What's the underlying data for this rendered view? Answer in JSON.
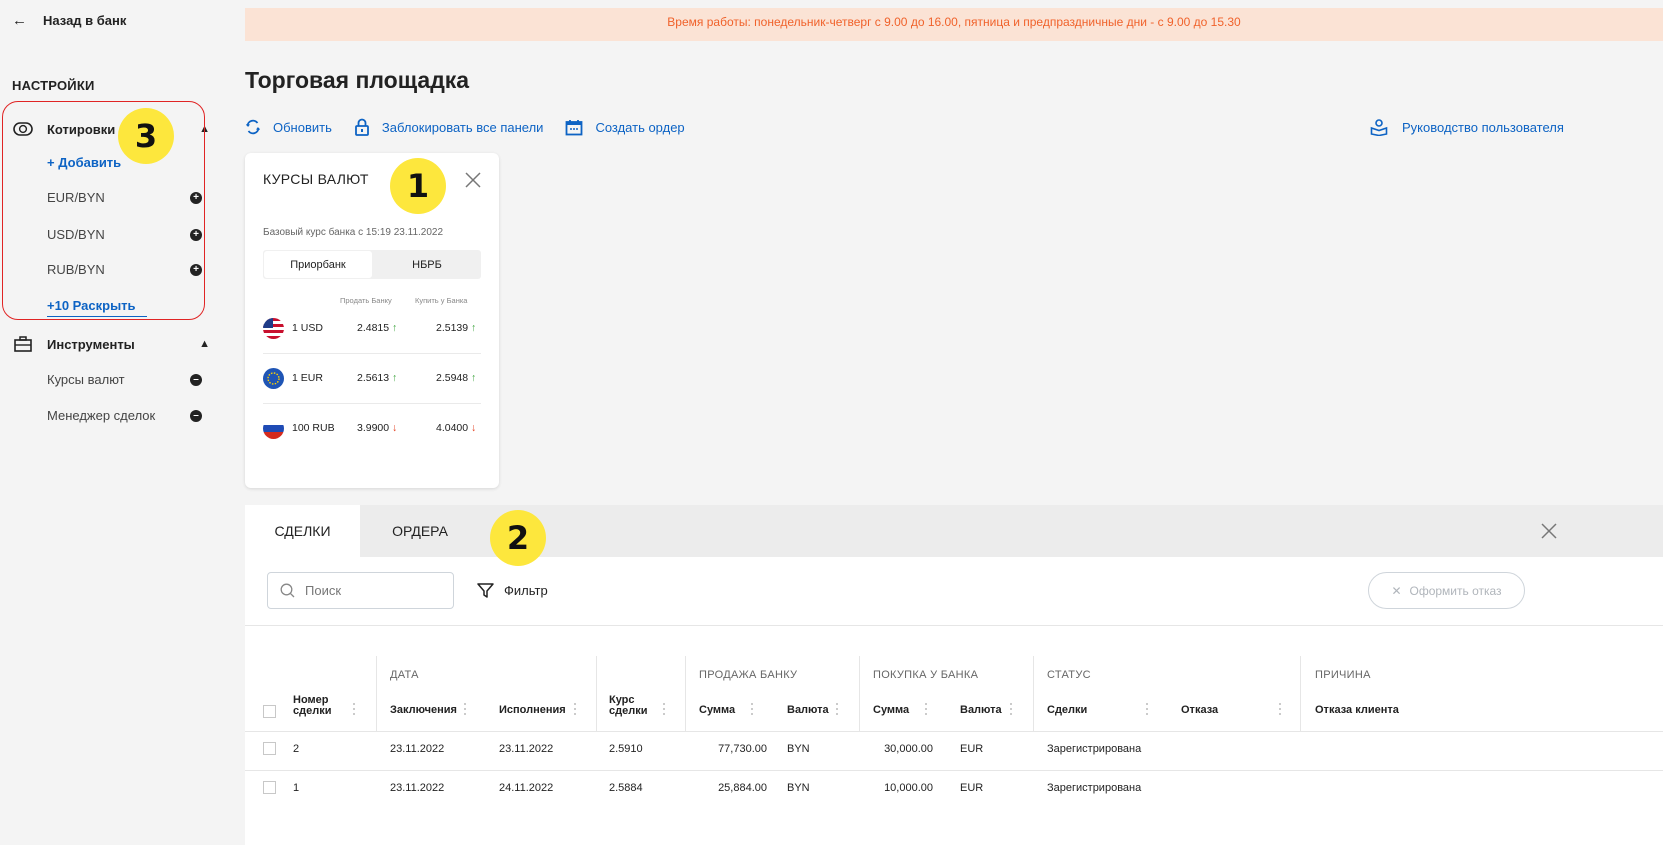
{
  "sidebar": {
    "back_label": "Назад в банк",
    "section_title": "НАСТРОЙКИ",
    "quotes": {
      "label": "Котировки",
      "add_label": "+ Добавить",
      "items": [
        "EUR/BYN",
        "USD/BYN",
        "RUB/BYN"
      ],
      "expand_label": "+10 Раскрыть"
    },
    "tools": {
      "label": "Инструменты",
      "items": [
        "Курсы валют",
        "Менеджер сделок"
      ]
    }
  },
  "annotations": {
    "badge1": "1",
    "badge2": "2",
    "badge3": "3"
  },
  "banner": "Время работы: понедельник-четверг с 9.00 до 16.00, пятница и предпраздничные дни - с 9.00 до 15.30",
  "page_title": "Торговая площадка",
  "toolbar": {
    "refresh": "Обновить",
    "lock_all": "Заблокировать все панели",
    "create_order": "Создать ордер",
    "user_guide": "Руководство пользователя"
  },
  "rates_card": {
    "title": "КУРСЫ ВАЛЮТ",
    "subtitle": "Базовый курс банка с 15:19 23.11.2022",
    "tabs": [
      "Приорбанк",
      "НБРБ"
    ],
    "col_sell": "Продать Банку",
    "col_buy": "Купить у Банка",
    "rows": [
      {
        "currency": "1 USD",
        "sell": "2.4815",
        "buy": "2.5139",
        "sell_dir": "up",
        "buy_dir": "up"
      },
      {
        "currency": "1 EUR",
        "sell": "2.5613",
        "buy": "2.5948",
        "sell_dir": "up",
        "buy_dir": "up"
      },
      {
        "currency": "100 RUB",
        "sell": "3.9900",
        "buy": "4.0400",
        "sell_dir": "down",
        "buy_dir": "down"
      }
    ],
    "arrow_up_color": "#3aa23a",
    "arrow_down_color": "#e33c1c"
  },
  "deals_panel": {
    "tabs": [
      "СДЕЛКИ",
      "ОРДЕРА"
    ],
    "search_placeholder": "Поиск",
    "filter_label": "Фильтр",
    "refuse_label": "Оформить отказ",
    "groups": {
      "date": "ДАТА",
      "sale": "ПРОДАЖА БАНКУ",
      "purchase": "ПОКУПКА У БАНКА",
      "status": "СТАТУС",
      "reason": "ПРИЧИНА"
    },
    "columns": {
      "deal_no": "Номер сделки",
      "concluded": "Заключения",
      "executed": "Исполнения",
      "rate": "Курс сделки",
      "sale_amount": "Сумма",
      "sale_currency": "Валюта",
      "purchase_amount": "Сумма",
      "purchase_currency": "Валюта",
      "deal_status": "Сделки",
      "refusal_status": "Отказа",
      "client_refusal": "Отказа клиента"
    },
    "rows": [
      {
        "no": "2",
        "concluded": "23.11.2022",
        "executed": "23.11.2022",
        "rate": "2.5910",
        "sale_amount": "77,730.00",
        "sale_currency": "BYN",
        "purchase_amount": "30,000.00",
        "purchase_currency": "EUR",
        "status": "Зарегистрирована"
      },
      {
        "no": "1",
        "concluded": "23.11.2022",
        "executed": "24.11.2022",
        "rate": "2.5884",
        "sale_amount": "25,884.00",
        "sale_currency": "BYN",
        "purchase_amount": "10,000.00",
        "purchase_currency": "EUR",
        "status": "Зарегистрирована"
      }
    ]
  },
  "colors": {
    "link_blue": "#0d63c4",
    "banner_bg": "#fbe3d5",
    "banner_text": "#f0622b",
    "highlight_red": "#e02424",
    "badge_yellow": "#fde73d"
  }
}
